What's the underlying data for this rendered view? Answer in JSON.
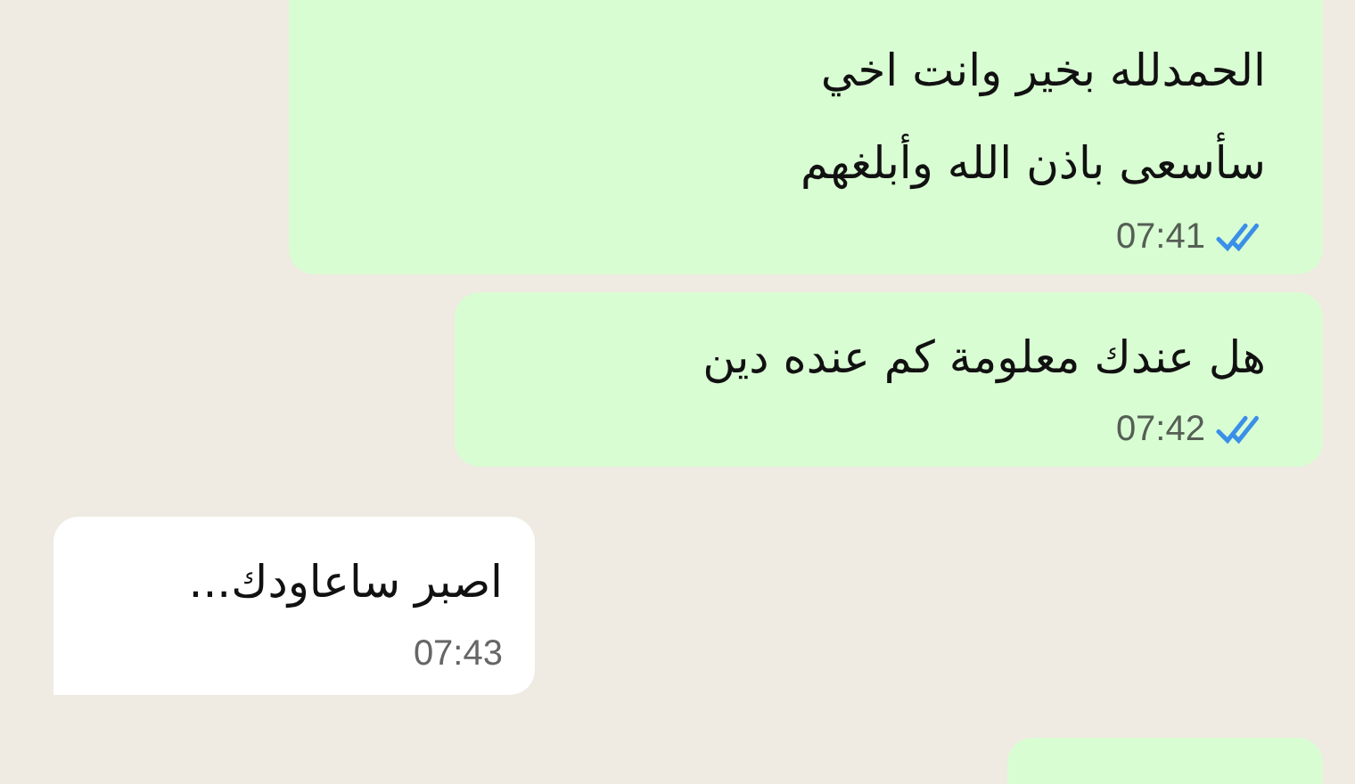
{
  "messages": [
    {
      "kind": "outgoing",
      "lines": [
        "الحمدلله بخير وانت اخي",
        "سأسعى باذن الله وأبلغهم"
      ],
      "time": "07:41",
      "read": true
    },
    {
      "kind": "outgoing",
      "lines": [
        "هل عندك معلومة كم عنده دين"
      ],
      "time": "07:42",
      "read": true
    },
    {
      "kind": "incoming",
      "lines": [
        "اصبر ساعاودك..."
      ],
      "time": "07:43"
    },
    {
      "kind": "outgoing"
    }
  ]
}
